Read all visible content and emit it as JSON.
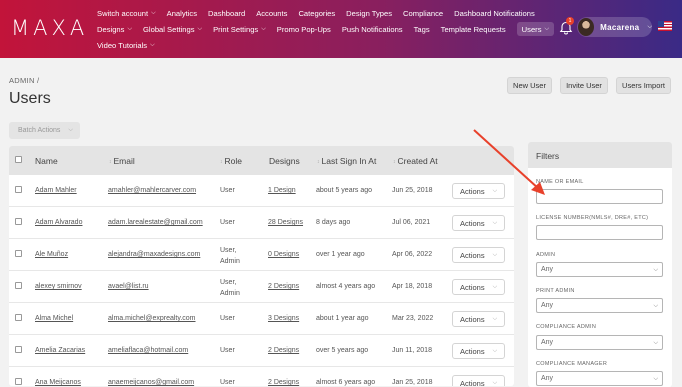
{
  "brand": {
    "logo_text": "MAXA"
  },
  "nav": {
    "row1": [
      {
        "label": "Switch account",
        "dropdown": true
      },
      {
        "label": "Analytics",
        "dropdown": false
      },
      {
        "label": "Dashboard",
        "dropdown": false
      },
      {
        "label": "Accounts",
        "dropdown": false
      },
      {
        "label": "Categories",
        "dropdown": false
      },
      {
        "label": "Design Types",
        "dropdown": false
      },
      {
        "label": "Compliance",
        "dropdown": false
      },
      {
        "label": "Dashboard Notifications",
        "dropdown": false
      }
    ],
    "row2": [
      {
        "label": "Designs",
        "dropdown": true
      },
      {
        "label": "Global Settings",
        "dropdown": true
      },
      {
        "label": "Print Settings",
        "dropdown": true
      },
      {
        "label": "Promo Pop-Ups",
        "dropdown": false
      },
      {
        "label": "Push Notifications",
        "dropdown": false
      },
      {
        "label": "Tags",
        "dropdown": false
      },
      {
        "label": "Template Requests",
        "dropdown": false
      },
      {
        "label": "Users",
        "dropdown": true,
        "active": true
      }
    ],
    "row3": [
      {
        "label": "Video Tutorials",
        "dropdown": true
      }
    ]
  },
  "header": {
    "notification_count": "1",
    "user_name": "Macarena",
    "flag_icon": "us-flag-icon",
    "bell_icon": "bell-icon"
  },
  "page": {
    "breadcrumb": "ADMIN  /",
    "title": "Users",
    "buttons": {
      "new_user": "New User",
      "invite_user": "Invite User",
      "users_import": "Users Import"
    },
    "batch_actions": "Batch Actions"
  },
  "table": {
    "columns": {
      "name": "Name",
      "email": "Email",
      "role": "Role",
      "designs": "Designs",
      "last_sign_in": "Last Sign In At",
      "created_at": "Created At"
    },
    "action_label": "Actions",
    "rows": [
      {
        "name": "Adam Mahler",
        "email": "amahler@mahlercarver.com",
        "role": "User",
        "designs": "1 Design",
        "last_sign_in": "about 5 years ago",
        "created_at": "Jun 25, 2018"
      },
      {
        "name": "Adam Alvarado",
        "email": "adam.larealestate@gmail.com",
        "role": "User",
        "designs": "28 Designs",
        "last_sign_in": "8 days ago",
        "created_at": "Jul 06, 2021"
      },
      {
        "name": "Ale Muñoz",
        "email": "alejandra@maxadesigns.com",
        "role": "User, Admin",
        "designs": "0 Designs",
        "last_sign_in": "over 1 year ago",
        "created_at": "Apr 06, 2022"
      },
      {
        "name": "alexey smirnov",
        "email": "avael@list.ru",
        "role": "User, Admin",
        "designs": "2 Designs",
        "last_sign_in": "almost 4 years ago",
        "created_at": "Apr 18, 2018"
      },
      {
        "name": "Alma Michel",
        "email": "alma.michel@exprealty.com",
        "role": "User",
        "designs": "3 Designs",
        "last_sign_in": "about 1 year ago",
        "created_at": "Mar 23, 2022"
      },
      {
        "name": "Amelia Zacarias",
        "email": "ameliaflaca@hotmail.com",
        "role": "User",
        "designs": "2 Designs",
        "last_sign_in": "over 5 years ago",
        "created_at": "Jun 11, 2018"
      },
      {
        "name": "Ana Meijcanos",
        "email": "anaemeijcanos@gmail.com",
        "role": "User",
        "designs": "2 Designs",
        "last_sign_in": "almost 6 years ago",
        "created_at": "Jan 25, 2018"
      }
    ]
  },
  "filters": {
    "title": "Filters",
    "fields": [
      {
        "label": "NAME OR EMAIL",
        "kind": "text",
        "value": ""
      },
      {
        "label": "LICENSE NUMBER(NMLS#, DRE#, ETC)",
        "kind": "text",
        "value": ""
      },
      {
        "label": "ADMIN",
        "kind": "select",
        "value": "Any"
      },
      {
        "label": "PRINT ADMIN",
        "kind": "select",
        "value": "Any"
      },
      {
        "label": "COMPLIANCE ADMIN",
        "kind": "select",
        "value": "Any"
      },
      {
        "label": "COMPLIANCE MANAGER",
        "kind": "select",
        "value": "Any"
      }
    ]
  },
  "annotation": {
    "arrow_color": "#e8412b"
  }
}
